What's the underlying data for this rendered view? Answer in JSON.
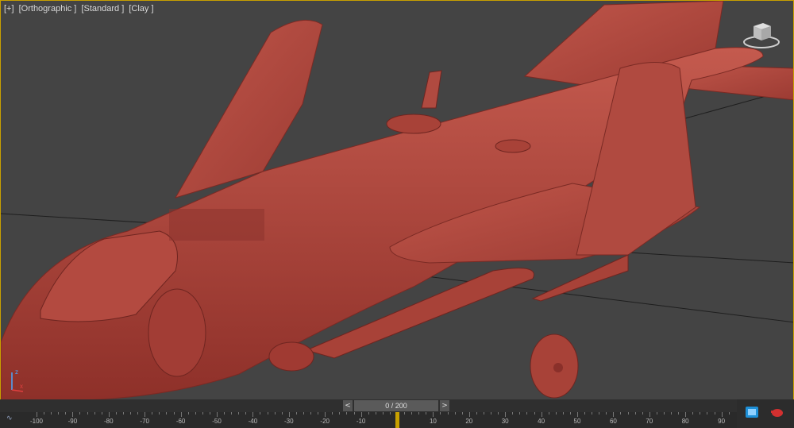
{
  "viewport": {
    "labels": [
      "[+]",
      "[Orthographic ]",
      "[Standard ]",
      "[Clay ]"
    ]
  },
  "viewcube": {
    "icon": "viewcube-icon"
  },
  "axes": {
    "z": "z",
    "x": "x"
  },
  "timeslider": {
    "prev": "<",
    "next": ">",
    "frame_text": "0 / 200"
  },
  "track_icon": "∿",
  "ruler": {
    "labels": [
      "-100",
      "-90",
      "-80",
      "-70",
      "-60",
      "-50",
      "-40",
      "-30",
      "-20",
      "-10",
      "0",
      "10",
      "20",
      "30",
      "40",
      "50",
      "60",
      "70",
      "80",
      "90"
    ]
  },
  "colors": {
    "accent": "#c8a000",
    "model_clay": "#b8483f",
    "background": "#444444"
  }
}
